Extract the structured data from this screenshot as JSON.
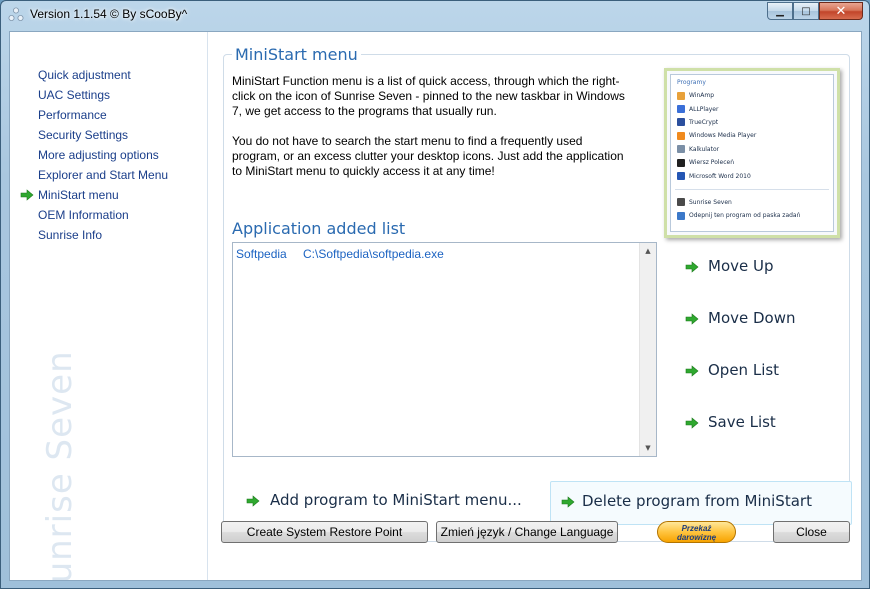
{
  "window": {
    "title": "Version 1.1.54 © By sCooBy^",
    "minimize_glyph": "▁",
    "maximize_glyph": "□",
    "close_glyph": "✕"
  },
  "sidebar": {
    "items": [
      {
        "label": "Quick adjustment"
      },
      {
        "label": "UAC Settings"
      },
      {
        "label": "Performance"
      },
      {
        "label": "Security Settings"
      },
      {
        "label": "More adjusting options"
      },
      {
        "label": "Explorer and Start Menu"
      },
      {
        "label": "MiniStart menu",
        "selected": true
      },
      {
        "label": "OEM Information"
      },
      {
        "label": "Sunrise Info"
      }
    ],
    "watermark": "Sunrise Seven"
  },
  "main": {
    "panel_title": "MiniStart menu",
    "description": [
      "MiniStart Function menu is a list of quick access, through which the right-click on the icon of Sunrise Seven - pinned to the new taskbar in Windows 7, we get access to the programs that usually run.",
      "You do not have to search the start menu to find a frequently used program, or an excess clutter your desktop icons. Just add the application to MiniStart menu to quickly access it at any time!"
    ],
    "preview": {
      "header": "Programy",
      "items": [
        {
          "label": "WinAmp",
          "color": "#e8a13a"
        },
        {
          "label": "ALLPlayer",
          "color": "#3a6fd8"
        },
        {
          "label": "TrueCrypt",
          "color": "#2b4f9e"
        },
        {
          "label": "Windows Media Player",
          "color": "#f08a1e"
        },
        {
          "label": "Kalkulator",
          "color": "#7b8fa6"
        },
        {
          "label": "Wiersz Poleceń",
          "color": "#202020"
        },
        {
          "label": "Microsoft Word 2010",
          "color": "#2456b4"
        }
      ],
      "footer": [
        {
          "label": "Sunrise Seven",
          "color": "#4a4a4a"
        },
        {
          "label": "Odepnij ten program od paska zadań",
          "color": "#3b78c9"
        }
      ]
    },
    "list_title": "Application added list",
    "list_rows": [
      {
        "name": "Softpedia",
        "path": "C:\\Softpedia\\softpedia.exe"
      }
    ],
    "scroll_up": "▲",
    "scroll_down": "▼",
    "actions": {
      "move_up": "Move Up",
      "move_down": "Move Down",
      "open_list": "Open List",
      "save_list": "Save List"
    },
    "add_program": "Add program to MiniStart menu...",
    "delete_program": "Delete program from MiniStart"
  },
  "buttons": {
    "restore_point": "Create System Restore Point",
    "change_language": "Zmień język / Change Language",
    "donate_line1": "Przekaż",
    "donate_line2": "darowiznę",
    "close": "Close"
  },
  "colors": {
    "accent_blue": "#2a6ab0",
    "arrow_green": "#2fa82f"
  }
}
